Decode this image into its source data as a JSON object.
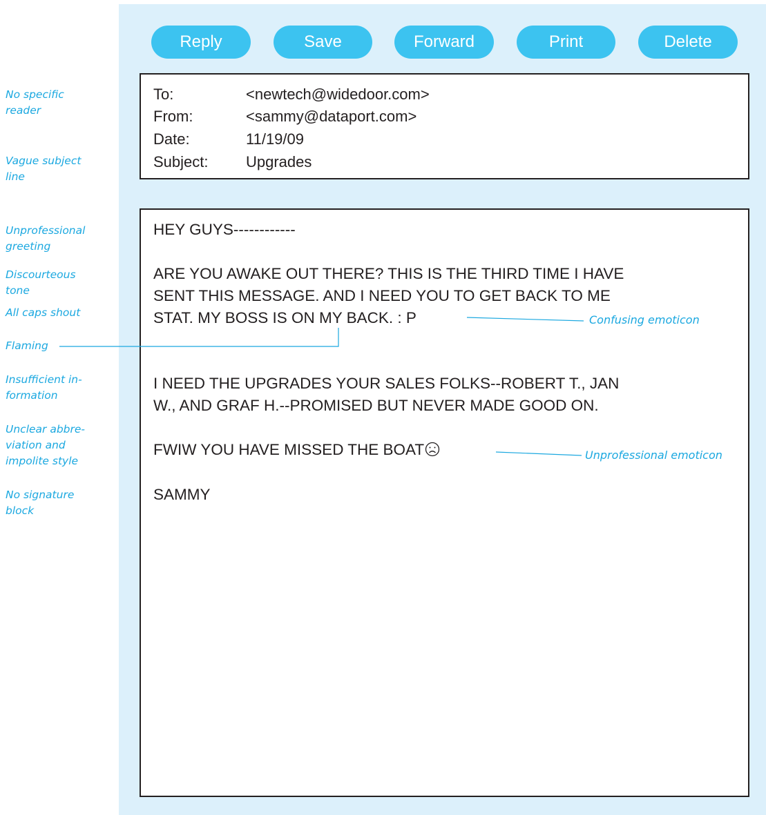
{
  "toolbar": {
    "reply_label": "Reply",
    "save_label": "Save",
    "forward_label": "Forward",
    "print_label": "Print",
    "delete_label": "Delete"
  },
  "header": {
    "to_label": "To:",
    "to_value": "<newtech@widedoor.com>",
    "from_label": "From:",
    "from_value": "<sammy@dataport.com>",
    "date_label": "Date:",
    "date_value": "11/19/09",
    "subject_label": "Subject:",
    "subject_value": "Upgrades"
  },
  "body": {
    "greeting": "HEY GUYS------------",
    "para1_line1": "ARE YOU AWAKE OUT THERE? THIS IS THE THIRD TIME I HAVE",
    "para1_line2": "SENT THIS MESSAGE. AND I NEED YOU TO GET BACK TO ME",
    "para1_line3": "STAT. MY BOSS IS ON MY BACK. : P",
    "para2_line1": "I NEED THE UPGRADES YOUR SALES FOLKS--ROBERT T., JAN",
    "para2_line2": "W., AND GRAF H.--PROMISED BUT NEVER MADE GOOD ON.",
    "para3": "FWIW YOU HAVE MISSED THE BOAT",
    "closing": "SAMMY",
    "emoticon_icon": "frown-face-icon"
  },
  "annotations": {
    "no_specific_reader": [
      "No specific",
      "reader"
    ],
    "vague_subject": [
      "Vague subject",
      "line"
    ],
    "unprofessional_greeting": [
      "Unprofessional",
      "greeting"
    ],
    "discourteous_tone": [
      "Discourteous",
      "tone"
    ],
    "all_caps": "All caps shout",
    "flaming": "Flaming",
    "insufficient_info": [
      "Insufficient in-",
      "formation"
    ],
    "unclear_abbreviation": [
      "Unclear abbre-",
      "viation and",
      "impolite style"
    ],
    "no_signature": [
      "No signature",
      "block"
    ],
    "confusing_emoticon": "Confusing  emoticon",
    "unprofessional_emoticon": "Unprofessional emoticon"
  },
  "colors": {
    "panel_bg": "#dcf0fb",
    "button_bg": "#3cc3f0",
    "annotation": "#1ba8e0",
    "text": "#231f20"
  }
}
